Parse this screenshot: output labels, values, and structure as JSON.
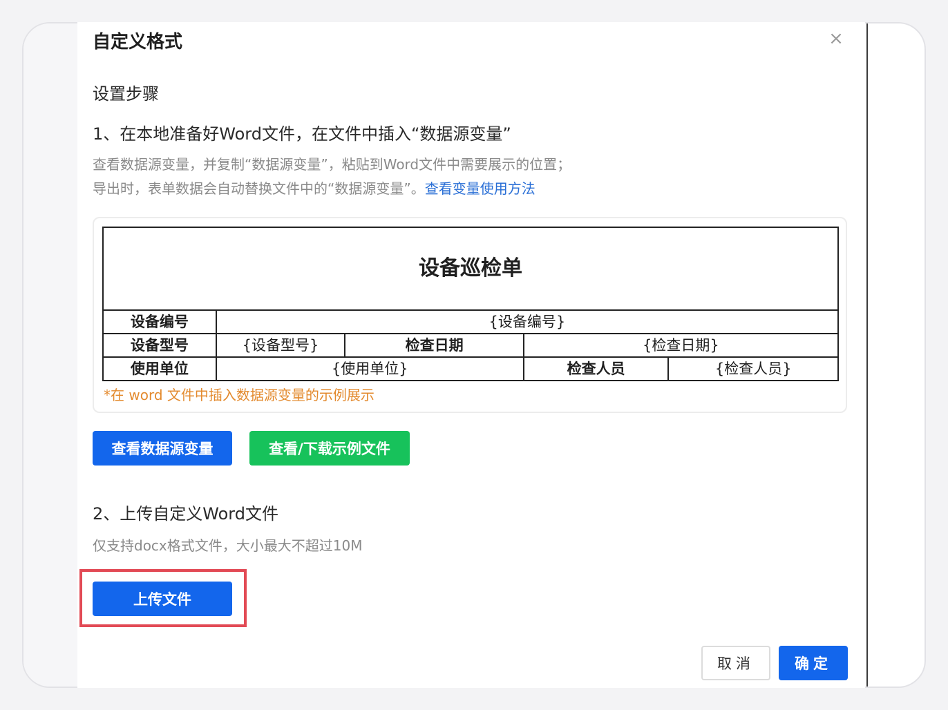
{
  "dialog": {
    "title": "自定义格式",
    "close_icon": "close-icon",
    "close_glyph": "×"
  },
  "setup": {
    "section_title": "设置步骤",
    "step1": {
      "title": "1、在本地准备好Word文件，在文件中插入“数据源变量”",
      "desc_line1": "查看数据源变量，并复制“数据源变量”，粘贴到Word文件中需要展示的位置；",
      "desc_line2": "导出时，表单数据会自动替换文件中的“数据源变量”。",
      "link": "查看变量使用方法"
    },
    "example": {
      "table_title": "设备巡检单",
      "rows": [
        {
          "label": "设备编号",
          "value": "{设备编号}"
        },
        {
          "label": "设备型号",
          "value": "{设备型号}",
          "label2": "检查日期",
          "value2": "{检查日期}"
        },
        {
          "label": "使用单位",
          "value": "{使用单位}",
          "label2": "检查人员",
          "value2": "{检查人员}"
        }
      ],
      "note": "*在 word 文件中插入数据源变量的示例展示"
    },
    "buttons": {
      "view_vars": "查看数据源变量",
      "view_sample": "查看/下载示例文件"
    },
    "step2": {
      "title": "2、上传自定义Word文件",
      "desc": "仅支持docx格式文件，大小最大不超过10M",
      "upload": "上传文件"
    }
  },
  "footer": {
    "cancel": "取消",
    "ok": "确定"
  },
  "colors": {
    "primary": "#1366ec",
    "success": "#17c25b",
    "link": "#2a6fd6",
    "note": "#e38a2e",
    "highlight": "#e24a55"
  }
}
